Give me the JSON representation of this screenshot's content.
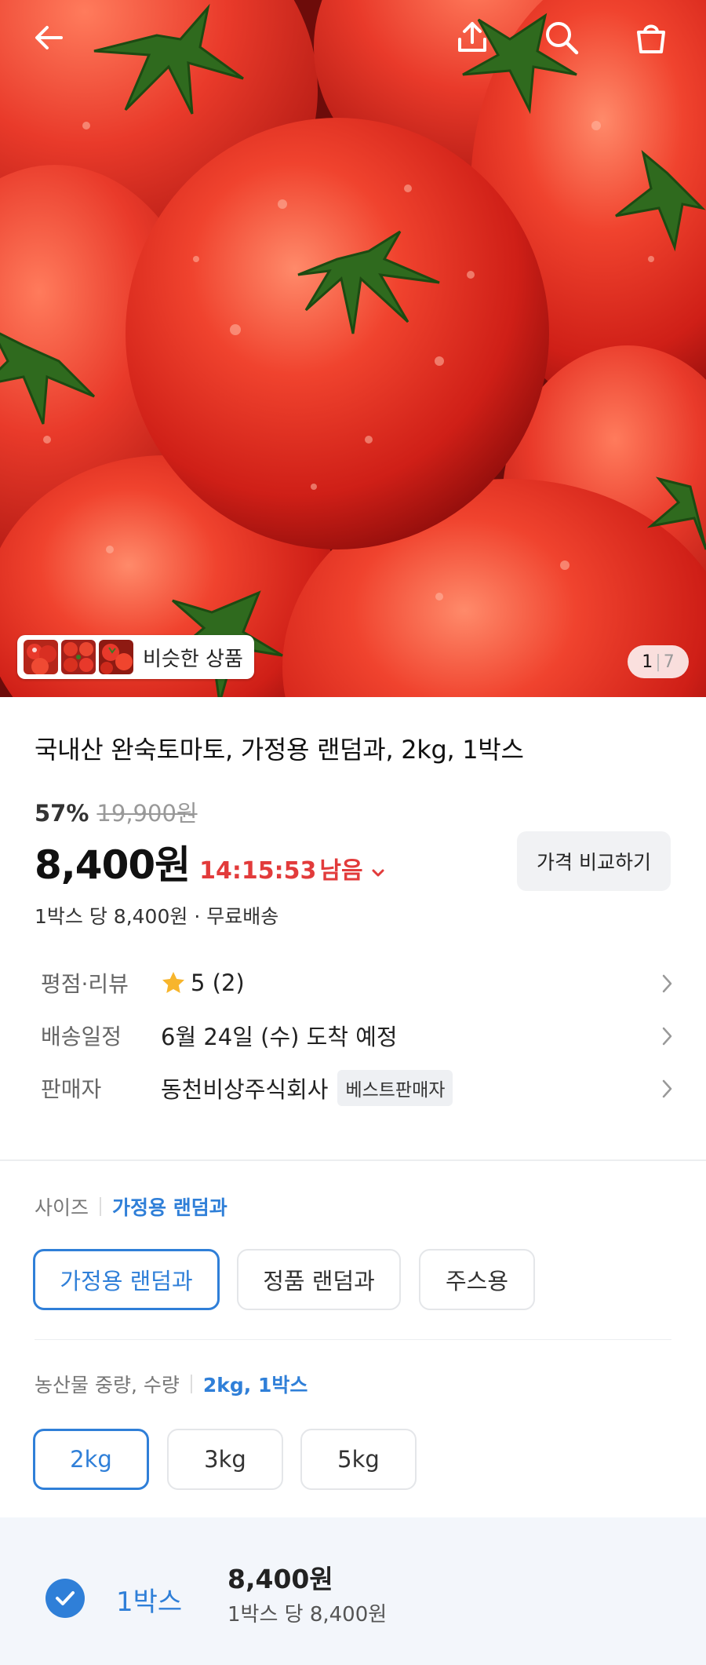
{
  "hero": {
    "similar_label": "비슷한 상품",
    "counter_current": "1",
    "counter_total": "7",
    "icons": [
      "back-arrow-icon",
      "share-icon",
      "search-icon",
      "cart-bag-icon"
    ]
  },
  "product": {
    "title": "국내산 완숙토마토, 가정용 랜덤과, 2kg, 1박스",
    "discount": "57%",
    "original_price": "19,900원",
    "price": "8,400원",
    "countdown": "14:15:53",
    "countdown_label": "남음",
    "compare_label": "가격 비교하기",
    "per_unit": "1박스 당 8,400원 · 무료배송"
  },
  "info": {
    "rating_label": "평점·리뷰",
    "rating_value": "5 (2)",
    "delivery_label": "배송일정",
    "delivery_value": "6월 24일 (수) 도착 예정",
    "seller_label": "판매자",
    "seller_value": "동천비상주식회사",
    "seller_badge": "베스트판매자"
  },
  "options": {
    "size": {
      "name": "사이즈",
      "selected": "가정용 랜덤과",
      "choices": [
        "가정용 랜덤과",
        "정품 랜덤과",
        "주스용"
      ]
    },
    "weight": {
      "name": "농산물 중량, 수량",
      "selected": "2kg, 1박스",
      "choices": [
        "2kg",
        "3kg",
        "5kg"
      ]
    }
  },
  "quantity": {
    "label": "1박스",
    "price": "8,400원",
    "per_unit": "1박스 당 8,400원"
  },
  "colors": {
    "accent": "#2f7fd8",
    "sale_red": "#e23b3b",
    "tomato": "#e8392b"
  }
}
